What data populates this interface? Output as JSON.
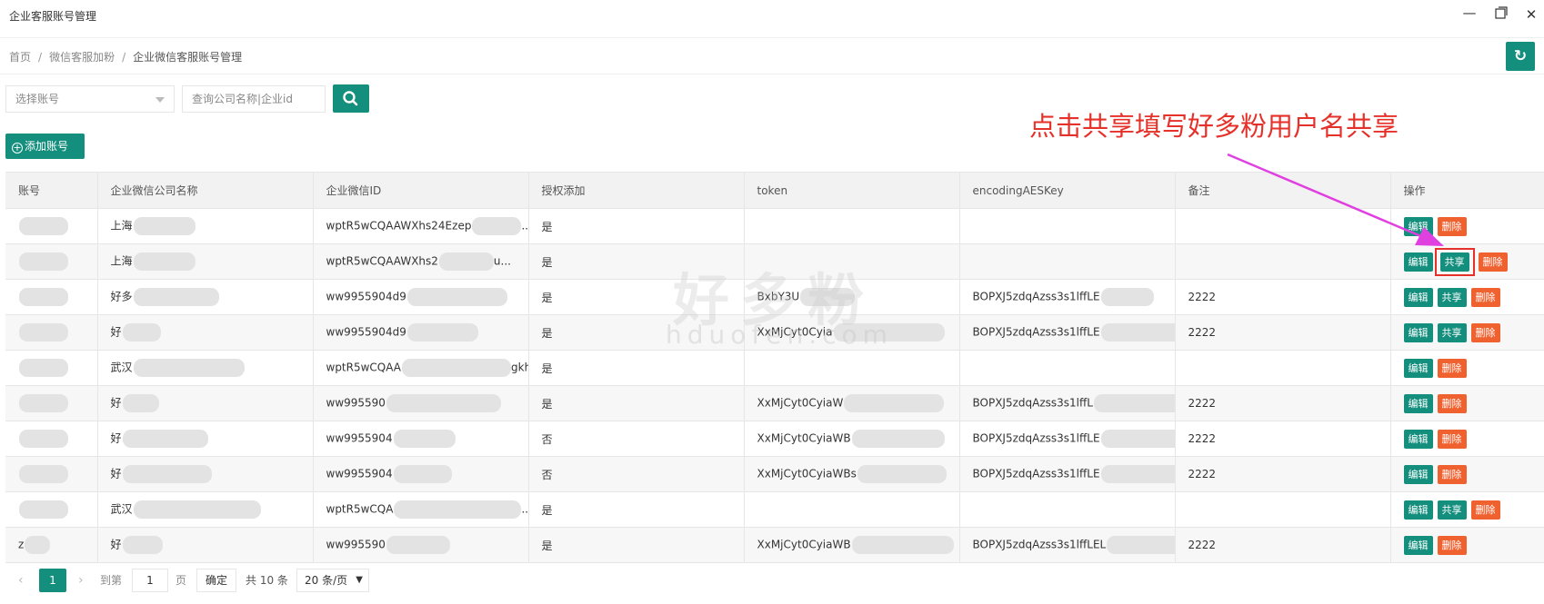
{
  "window": {
    "title": "企业客服账号管理",
    "controls": [
      "minimize-icon",
      "maximize-icon",
      "close-icon"
    ]
  },
  "breadcrumb": [
    {
      "label": "首页"
    },
    {
      "label": "微信客服加粉"
    },
    {
      "label": "企业微信客服账号管理"
    }
  ],
  "breadcrumb_sep": "/",
  "filters": {
    "account_select_placeholder": "选择账号",
    "search_placeholder": "查询公司名称|企业id"
  },
  "toolbar": {
    "add_label": "添加账号"
  },
  "annotation": {
    "text": "点击共享填写好多粉用户名共享",
    "color": "#e5312a"
  },
  "watermark": {
    "title": "好多粉",
    "url": "hduofen.com"
  },
  "table": {
    "headers": [
      "账号",
      "企业微信公司名称",
      "企业微信ID",
      "授权添加",
      "token",
      "encodingAESKey",
      "备注",
      "操作"
    ],
    "rows": [
      {
        "account": "",
        "company": "上海",
        "corp_id": "wptR5wCQAAWXhs24Ezep",
        "corp_id_tail": "...",
        "auth": "是",
        "token": "",
        "aes": "",
        "remark": "",
        "ops": [
          "编辑",
          "删除"
        ]
      },
      {
        "account": "",
        "company": "上海",
        "corp_id": "wptR5wCQAAWXhs2",
        "corp_id_tail": "u...",
        "auth": "是",
        "token": "",
        "aes": "",
        "remark": "",
        "ops": [
          "编辑",
          "共享",
          "删除"
        ],
        "share_highlight": true
      },
      {
        "account": "",
        "company": "好多",
        "corp_id": "ww9955904d9",
        "corp_id_tail": "",
        "auth": "是",
        "token": "BxbY3U",
        "aes": "BOPXJ5zdqAzss3s1lffLE",
        "remark": "2222",
        "ops": [
          "编辑",
          "共享",
          "删除"
        ]
      },
      {
        "account": "",
        "company": "好",
        "corp_id": "ww9955904d9",
        "corp_id_tail": "",
        "auth": "是",
        "token": "XxMjCyt0Cyia",
        "aes": "BOPXJ5zdqAzss3s1lffLE",
        "remark": "2222",
        "ops": [
          "编辑",
          "共享",
          "删除"
        ]
      },
      {
        "account": "",
        "company": "武汉",
        "corp_id": "wptR5wCQAA",
        "corp_id_tail": "gkhn...",
        "auth": "是",
        "token": "",
        "aes": "",
        "remark": "",
        "ops": [
          "编辑",
          "删除"
        ]
      },
      {
        "account": "",
        "company": "好",
        "corp_id": "ww995590",
        "corp_id_tail": "",
        "auth": "是",
        "token": "XxMjCyt0CyiaW",
        "aes": "BOPXJ5zdqAzss3s1lffL",
        "remark": "2222",
        "ops": [
          "编辑",
          "删除"
        ]
      },
      {
        "account": "",
        "company": "好",
        "corp_id": "ww9955904",
        "corp_id_tail": "",
        "auth": "否",
        "token": "XxMjCyt0CyiaWB",
        "aes": "BOPXJ5zdqAzss3s1lffLE",
        "remark": "2222",
        "ops": [
          "编辑",
          "删除"
        ]
      },
      {
        "account": "",
        "company": "好",
        "corp_id": "ww9955904",
        "corp_id_tail": "",
        "auth": "否",
        "token": "XxMjCyt0CyiaWBs",
        "aes": "BOPXJ5zdqAzss3s1lffLE",
        "remark": "2222",
        "ops": [
          "编辑",
          "删除"
        ]
      },
      {
        "account": "",
        "company": "武汉",
        "corp_id": "wptR5wCQA",
        "corp_id_tail": "...",
        "auth": "是",
        "token": "",
        "aes": "",
        "remark": "",
        "ops": [
          "编辑",
          "共享",
          "删除"
        ]
      },
      {
        "account": "z",
        "company": "好",
        "corp_id": "ww995590",
        "corp_id_tail": "",
        "auth": "是",
        "token": "XxMjCyt0CyiaWB",
        "aes": "BOPXJ5zdqAzss3s1lffLEL",
        "remark": "2222",
        "ops": [
          "编辑",
          "删除"
        ]
      }
    ]
  },
  "pagination": {
    "current_page": "1",
    "goto_prefix": "到第",
    "goto_value": "1",
    "goto_suffix": "页",
    "confirm_label": "确定",
    "total_label": "共 10 条",
    "page_size_label": "20 条/页"
  },
  "colors": {
    "primary": "#148e7d",
    "danger": "#f06130",
    "annotation_arrow": "#e040e0"
  }
}
